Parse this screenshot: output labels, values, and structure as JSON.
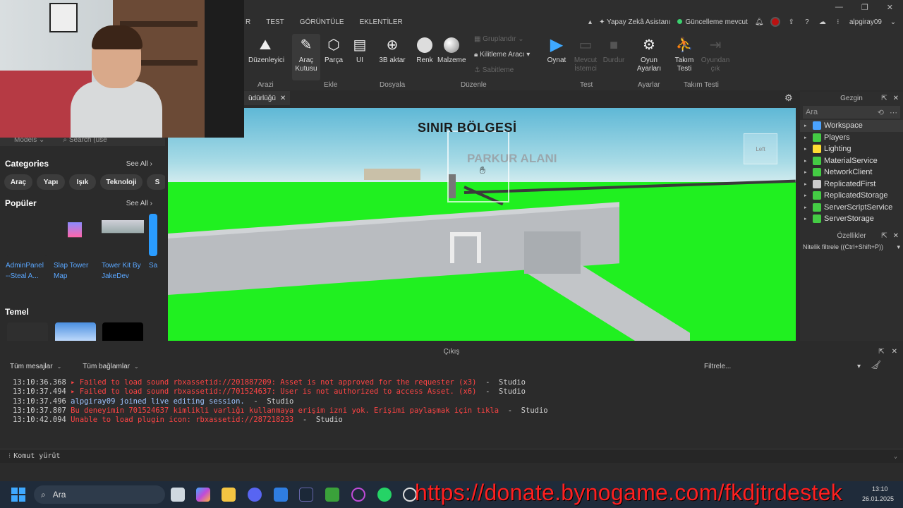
{
  "topbar": {
    "ai_assistant": "Yapay Zekâ Asistanı",
    "update": "Güncelleme mevcut",
    "username": "alpgiray09"
  },
  "menu": [
    "R",
    "TEST",
    "GÖRÜNTÜLE",
    "EKLENTİLER"
  ],
  "ribbon": {
    "editor_label": "Düzenleyici",
    "toolbox_label": "Araç Kutusu",
    "part_label": "Parça",
    "ui_label": "UI",
    "import3d_label": "3B aktar",
    "color_label": "Renk",
    "material_label": "Malzeme",
    "group_label": "Gruplandır",
    "lock_tool_label": "Kilitleme Aracı",
    "anchor_label": "Sabitleme",
    "play_label": "Oynat",
    "current_client_label": "Mevcut İstemci",
    "stop_label": "Durdur",
    "game_settings_label": "Oyun Ayarları",
    "team_test_label": "Takım Testi",
    "leave_game_label": "Oyundan çık",
    "groups": {
      "terrain": "Arazi",
      "insert": "Ekle",
      "file": "Dosyala",
      "edit": "Düzenle",
      "test": "Test",
      "settings": "Ayarlar",
      "team_test": "Takım Testi"
    }
  },
  "tabs": [
    {
      "label": "üdürlüğü"
    }
  ],
  "toolbox": {
    "models_label": "Models",
    "search_placeholder": "Search (use",
    "categories_title": "Categories",
    "see_all": "See All",
    "categories": [
      "Araç",
      "Yapı",
      "Işık",
      "Teknoloji",
      "S"
    ],
    "popular_title": "Popüler",
    "assets": [
      {
        "line1": "AdminPanel",
        "line2": "--Steal A..."
      },
      {
        "line1": "Slap Tower",
        "line2": "Map"
      },
      {
        "line1": "Tower Kit By",
        "line2": "JakeDev"
      },
      {
        "line1": "Sa",
        "line2": ""
      }
    ],
    "basic_title": "Temel"
  },
  "viewport": {
    "title": "SINIR BÖLGESİ",
    "subtitle": "PARKUR ALANI",
    "viewcube_label": "Left"
  },
  "explorer": {
    "title": "Gezgin",
    "search_placeholder": "Ara",
    "items": [
      {
        "label": "Workspace",
        "color": "#4aa3ff"
      },
      {
        "label": "Players",
        "color": "#44cc44"
      },
      {
        "label": "Lighting",
        "color": "#ffdd33"
      },
      {
        "label": "MaterialService",
        "color": "#44cc44"
      },
      {
        "label": "NetworkClient",
        "color": "#44cc44"
      },
      {
        "label": "ReplicatedFirst",
        "color": "#cccccc"
      },
      {
        "label": "ReplicatedStorage",
        "color": "#44cc44"
      },
      {
        "label": "ServerScriptService",
        "color": "#44cc44"
      },
      {
        "label": "ServerStorage",
        "color": "#44cc44"
      }
    ]
  },
  "properties": {
    "title": "Özellikler",
    "filter": "Nitelik filtrele ((Ctrl+Shift+P))"
  },
  "output": {
    "title": "Çıkış",
    "all_messages": "Tüm mesajlar",
    "all_contexts": "Tüm bağlamlar",
    "filter_placeholder": "Filtrele...",
    "lines": [
      {
        "time": "13:10:36.368",
        "text": " ▸ Failed to load sound rbxassetid://201887209: Asset is not approved for the requester (x3)",
        "source": "  -  Studio",
        "kind": "err"
      },
      {
        "time": "13:10:37.494",
        "text": " ▸ Failed to load sound rbxassetid://701524637: User is not authorized to access Asset. (x6)",
        "source": "  -  Studio",
        "kind": "err"
      },
      {
        "time": "13:10:37.496",
        "text": " alpgiray09 joined live editing session.",
        "source": "  -  Studio",
        "kind": "info"
      },
      {
        "time": "13:10:37.807",
        "text": " Bu deneyimin 701524637 kimlikli varlığı kullanmaya erişim izni yok. Erişimi paylaşmak için tıkla",
        "source": "  -  Studio",
        "kind": "err"
      },
      {
        "time": "13:10:42.094",
        "text": " Unable to load plugin icon: rbxassetid://287218233",
        "source": "  -  Studio",
        "kind": "err"
      }
    ],
    "command_placeholder": "Komut yürüt"
  },
  "taskbar": {
    "search_label": "Ara",
    "clock_time": "13:10",
    "clock_date": "26.01.2025"
  },
  "overlay": {
    "donate_url": "https://donate.bynogame.com/fkdjtrdestek"
  }
}
